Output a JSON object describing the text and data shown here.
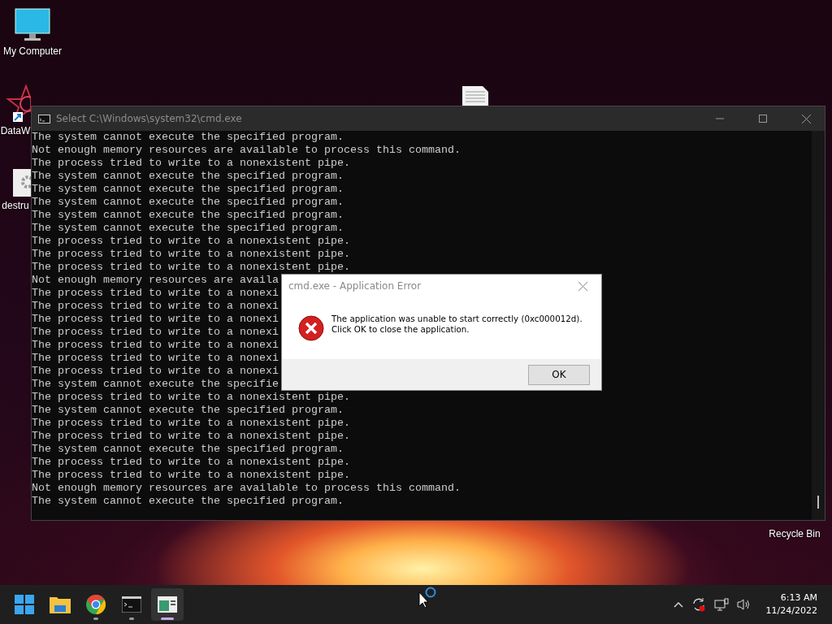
{
  "desktop_icons": [
    {
      "kind": "monitor",
      "label": "My Computer"
    },
    {
      "kind": "star",
      "label": "DataW"
    },
    {
      "kind": "gear-file",
      "label": "destru"
    },
    {
      "kind": "document"
    },
    {
      "kind": "label-only",
      "label": "Recycle Bin"
    }
  ],
  "console_window": {
    "title": "Select C:\\Windows\\system32\\cmd.exe",
    "lines": [
      "The system cannot execute the specified program.",
      "Not enough memory resources are available to process this command.",
      "The process tried to write to a nonexistent pipe.",
      "The system cannot execute the specified program.",
      "The system cannot execute the specified program.",
      "The system cannot execute the specified program.",
      "The system cannot execute the specified program.",
      "The system cannot execute the specified program.",
      "The process tried to write to a nonexistent pipe.",
      "The process tried to write to a nonexistent pipe.",
      "The process tried to write to a nonexistent pipe.",
      "Not enough memory resources are availa",
      "The process tried to write to a nonexi",
      "The process tried to write to a nonexi",
      "The process tried to write to a nonexi",
      "The process tried to write to a nonexi",
      "The process tried to write to a nonexi",
      "The process tried to write to a nonexi",
      "The process tried to write to a nonexi",
      "The system cannot execute the specifie",
      "The process tried to write to a nonexistent pipe.",
      "The system cannot execute the specified program.",
      "The process tried to write to a nonexistent pipe.",
      "The process tried to write to a nonexistent pipe.",
      "The system cannot execute the specified program.",
      "The process tried to write to a nonexistent pipe.",
      "The process tried to write to a nonexistent pipe.",
      "Not enough memory resources are available to process this command.",
      "The system cannot execute the specified program."
    ]
  },
  "dialog": {
    "title": "cmd.exe - Application Error",
    "message": [
      "The application was unable to start correctly (0xc000012d).",
      "Click OK to close the application."
    ],
    "button": "OK"
  },
  "taskbar": {
    "apps": [
      {
        "kind": "start",
        "running": false,
        "selected": false
      },
      {
        "kind": "explorer",
        "running": false,
        "selected": false
      },
      {
        "kind": "chrome",
        "running": true,
        "selected": false
      },
      {
        "kind": "terminal",
        "running": true,
        "selected": false
      },
      {
        "kind": "app",
        "running": true,
        "selected": true
      }
    ],
    "time": "6:13 AM",
    "date": "11/24/2022"
  }
}
